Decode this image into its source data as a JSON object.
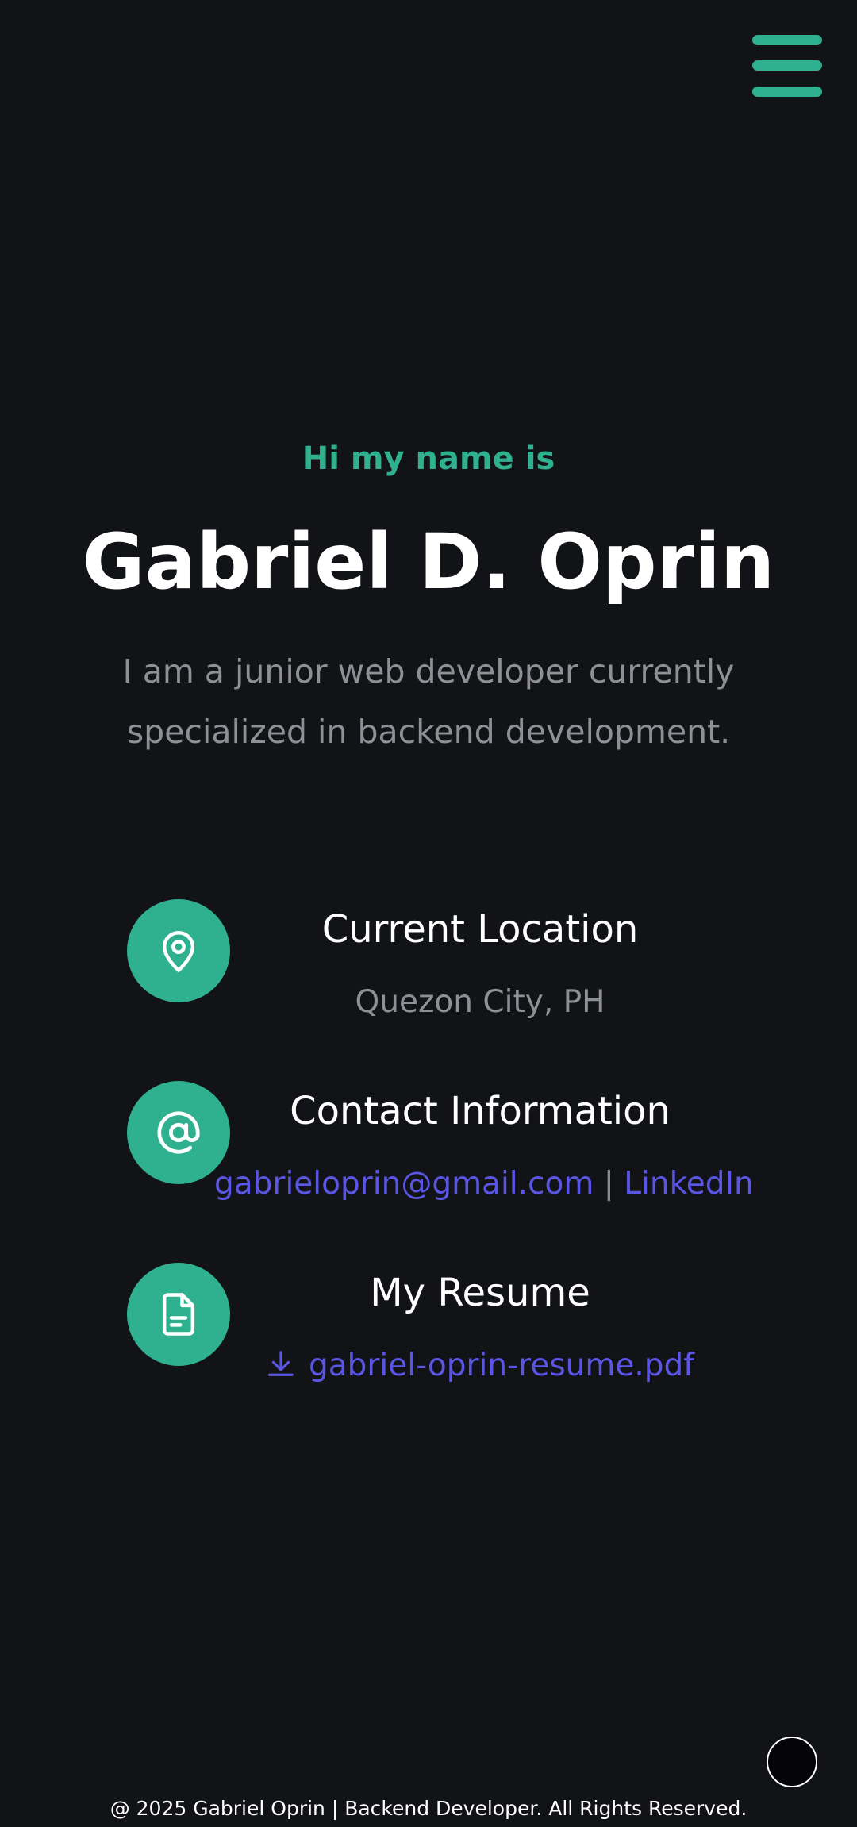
{
  "menu": {
    "icon": "hamburger-menu-icon"
  },
  "hero": {
    "greeting": "Hi my name is",
    "name": "Gabriel D. Oprin",
    "tagline_line1": "I am a junior web developer currently",
    "tagline_line2": "specialized in backend development."
  },
  "info": {
    "location": {
      "icon": "map-pin-icon",
      "title": "Current Location",
      "value": "Quezon City, PH"
    },
    "contact": {
      "icon": "at-sign-icon",
      "title": "Contact Information",
      "email": "gabrieloprin@gmail.com",
      "separator": "|",
      "linkedin": "LinkedIn"
    },
    "resume": {
      "icon": "document-icon",
      "title": "My Resume",
      "download_icon": "download-icon",
      "file": "gabriel-oprin-resume.pdf"
    }
  },
  "scroll_top": {
    "icon": "scroll-to-top-button"
  },
  "footer": {
    "text": "@ 2025 Gabriel Oprin | Backend Developer. All Rights Reserved."
  },
  "colors": {
    "background": "#121317",
    "accent": "#2fb08f",
    "link": "#5a56e3",
    "muted_text": "#8f9096",
    "text": "#ffffff"
  }
}
